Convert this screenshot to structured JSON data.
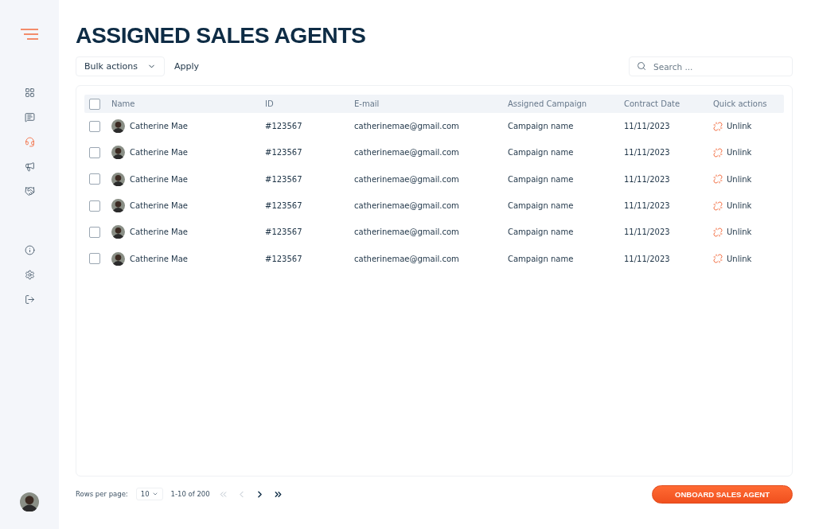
{
  "sidebar": {
    "nav_items": [
      {
        "kind": "dashboard",
        "selected": false
      },
      {
        "kind": "messages",
        "selected": false
      },
      {
        "kind": "headset",
        "selected": true
      },
      {
        "kind": "megaphone",
        "selected": false
      },
      {
        "kind": "handshake",
        "selected": false
      }
    ],
    "bottom_items": [
      {
        "kind": "info"
      },
      {
        "kind": "settings"
      },
      {
        "kind": "logout"
      }
    ]
  },
  "title": "ASSIGNED SALES AGENTS",
  "toolbar": {
    "bulk_actions": "Bulk actions",
    "apply": "Apply",
    "search": {
      "placeholder": "Search ..."
    }
  },
  "table": {
    "select_all": {
      "checked": false
    },
    "columns": [
      "Name",
      "ID",
      "E-mail",
      "Assigned Campaign",
      "Contract Date",
      "Quick actions"
    ],
    "rows": [
      {
        "checked": false,
        "name": "Catherine Mae",
        "id": "#123567",
        "email": "catherinemae@gmail.com",
        "campaign": "Campaign name",
        "date": "11/11/2023",
        "action": "Unlink"
      },
      {
        "checked": false,
        "name": "Catherine Mae",
        "id": "#123567",
        "email": "catherinemae@gmail.com",
        "campaign": "Campaign name",
        "date": "11/11/2023",
        "action": "Unlink"
      },
      {
        "checked": false,
        "name": "Catherine Mae",
        "id": "#123567",
        "email": "catherinemae@gmail.com",
        "campaign": "Campaign name",
        "date": "11/11/2023",
        "action": "Unlink"
      },
      {
        "checked": false,
        "name": "Catherine Mae",
        "id": "#123567",
        "email": "catherinemae@gmail.com",
        "campaign": "Campaign name",
        "date": "11/11/2023",
        "action": "Unlink"
      },
      {
        "checked": false,
        "name": "Catherine Mae",
        "id": "#123567",
        "email": "catherinemae@gmail.com",
        "campaign": "Campaign name",
        "date": "11/11/2023",
        "action": "Unlink"
      },
      {
        "checked": false,
        "name": "Catherine Mae",
        "id": "#123567",
        "email": "catherinemae@gmail.com",
        "campaign": "Campaign name",
        "date": "11/11/2023",
        "action": "Unlink"
      }
    ]
  },
  "footer": {
    "rows_per_page_label": "Rows per page:",
    "rows_per_page": "10",
    "range": "1-10 of 200",
    "pager": [
      {
        "kind": "first",
        "disabled": true
      },
      {
        "kind": "prev",
        "disabled": true
      },
      {
        "kind": "next",
        "disabled": false
      },
      {
        "kind": "last",
        "disabled": false
      }
    ],
    "primary_button": "ONBOARD SALES AGENT"
  }
}
